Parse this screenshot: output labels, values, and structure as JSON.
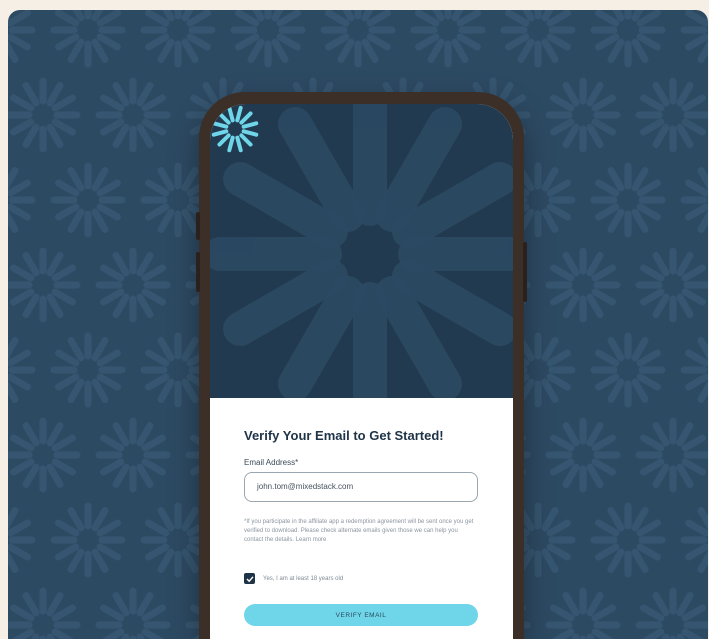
{
  "colors": {
    "background": "#f6efe6",
    "card": "#2d4a63",
    "hero": "#223a4f",
    "accent": "#6fd6ea",
    "primary_text": "#1f3347"
  },
  "icons": [
    "logo-burst-icon",
    "checkmark-icon"
  ],
  "form": {
    "heading": "Verify Your Email to Get Started!",
    "email_label": "Email Address*",
    "email_value": "john.tom@mixedstack.com",
    "disclaimer": "*If you participate in the affiliate app a redemption agreement will be sent once you get verified to download. Please check alternate emails given those we can help you contact the details. Learn more",
    "disclaimer_link": "Learn More",
    "checkbox_label": "Yes, I am at least 18 years old",
    "checkbox_checked": true,
    "verify_button": "VERIFY EMAIL"
  }
}
